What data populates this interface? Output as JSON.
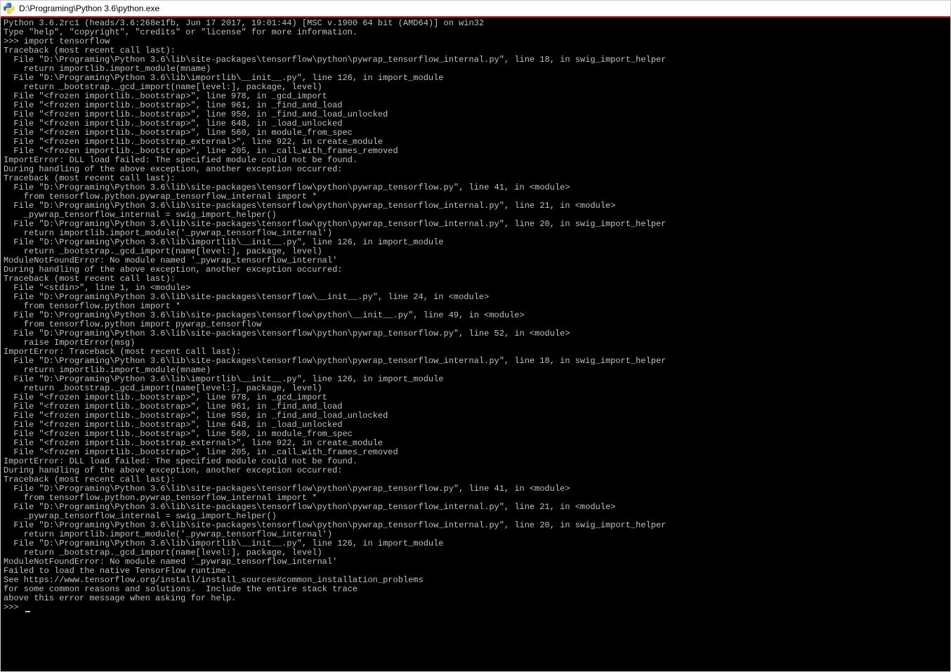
{
  "titlebar": {
    "title": "D:\\Programing\\Python 3.6\\python.exe"
  },
  "console": {
    "lines": [
      "Python 3.6.2rc1 (heads/3.6:268e1fb, Jun 17 2017, 19:01:44) [MSC v.1900 64 bit (AMD64)] on win32",
      "Type \"help\", \"copyright\", \"credits\" or \"license\" for more information.",
      ">>> import tensorflow",
      "Traceback (most recent call last):",
      "  File \"D:\\Programing\\Python 3.6\\lib\\site-packages\\tensorflow\\python\\pywrap_tensorflow_internal.py\", line 18, in swig_import_helper",
      "    return importlib.import_module(mname)",
      "  File \"D:\\Programing\\Python 3.6\\lib\\importlib\\__init__.py\", line 126, in import_module",
      "    return _bootstrap._gcd_import(name[level:], package, level)",
      "  File \"<frozen importlib._bootstrap>\", line 978, in _gcd_import",
      "  File \"<frozen importlib._bootstrap>\", line 961, in _find_and_load",
      "  File \"<frozen importlib._bootstrap>\", line 950, in _find_and_load_unlocked",
      "  File \"<frozen importlib._bootstrap>\", line 648, in _load_unlocked",
      "  File \"<frozen importlib._bootstrap>\", line 560, in module_from_spec",
      "  File \"<frozen importlib._bootstrap_external>\", line 922, in create_module",
      "  File \"<frozen importlib._bootstrap>\", line 205, in _call_with_frames_removed",
      "ImportError: DLL load failed: The specified module could not be found.",
      "",
      "During handling of the above exception, another exception occurred:",
      "",
      "Traceback (most recent call last):",
      "  File \"D:\\Programing\\Python 3.6\\lib\\site-packages\\tensorflow\\python\\pywrap_tensorflow.py\", line 41, in <module>",
      "    from tensorflow.python.pywrap_tensorflow_internal import *",
      "  File \"D:\\Programing\\Python 3.6\\lib\\site-packages\\tensorflow\\python\\pywrap_tensorflow_internal.py\", line 21, in <module>",
      "    _pywrap_tensorflow_internal = swig_import_helper()",
      "  File \"D:\\Programing\\Python 3.6\\lib\\site-packages\\tensorflow\\python\\pywrap_tensorflow_internal.py\", line 20, in swig_import_helper",
      "    return importlib.import_module('_pywrap_tensorflow_internal')",
      "  File \"D:\\Programing\\Python 3.6\\lib\\importlib\\__init__.py\", line 126, in import_module",
      "    return _bootstrap._gcd_import(name[level:], package, level)",
      "ModuleNotFoundError: No module named '_pywrap_tensorflow_internal'",
      "",
      "During handling of the above exception, another exception occurred:",
      "",
      "Traceback (most recent call last):",
      "  File \"<stdin>\", line 1, in <module>",
      "  File \"D:\\Programing\\Python 3.6\\lib\\site-packages\\tensorflow\\__init__.py\", line 24, in <module>",
      "    from tensorflow.python import *",
      "  File \"D:\\Programing\\Python 3.6\\lib\\site-packages\\tensorflow\\python\\__init__.py\", line 49, in <module>",
      "    from tensorflow.python import pywrap_tensorflow",
      "  File \"D:\\Programing\\Python 3.6\\lib\\site-packages\\tensorflow\\python\\pywrap_tensorflow.py\", line 52, in <module>",
      "    raise ImportError(msg)",
      "ImportError: Traceback (most recent call last):",
      "  File \"D:\\Programing\\Python 3.6\\lib\\site-packages\\tensorflow\\python\\pywrap_tensorflow_internal.py\", line 18, in swig_import_helper",
      "    return importlib.import_module(mname)",
      "  File \"D:\\Programing\\Python 3.6\\lib\\importlib\\__init__.py\", line 126, in import_module",
      "    return _bootstrap._gcd_import(name[level:], package, level)",
      "  File \"<frozen importlib._bootstrap>\", line 978, in _gcd_import",
      "  File \"<frozen importlib._bootstrap>\", line 961, in _find_and_load",
      "  File \"<frozen importlib._bootstrap>\", line 950, in _find_and_load_unlocked",
      "  File \"<frozen importlib._bootstrap>\", line 648, in _load_unlocked",
      "  File \"<frozen importlib._bootstrap>\", line 560, in module_from_spec",
      "  File \"<frozen importlib._bootstrap_external>\", line 922, in create_module",
      "  File \"<frozen importlib._bootstrap>\", line 205, in _call_with_frames_removed",
      "ImportError: DLL load failed: The specified module could not be found.",
      "",
      "During handling of the above exception, another exception occurred:",
      "",
      "Traceback (most recent call last):",
      "  File \"D:\\Programing\\Python 3.6\\lib\\site-packages\\tensorflow\\python\\pywrap_tensorflow.py\", line 41, in <module>",
      "    from tensorflow.python.pywrap_tensorflow_internal import *",
      "  File \"D:\\Programing\\Python 3.6\\lib\\site-packages\\tensorflow\\python\\pywrap_tensorflow_internal.py\", line 21, in <module>",
      "    _pywrap_tensorflow_internal = swig_import_helper()",
      "  File \"D:\\Programing\\Python 3.6\\lib\\site-packages\\tensorflow\\python\\pywrap_tensorflow_internal.py\", line 20, in swig_import_helper",
      "    return importlib.import_module('_pywrap_tensorflow_internal')",
      "  File \"D:\\Programing\\Python 3.6\\lib\\importlib\\__init__.py\", line 126, in import_module",
      "    return _bootstrap._gcd_import(name[level:], package, level)",
      "ModuleNotFoundError: No module named '_pywrap_tensorflow_internal'",
      "",
      "",
      "Failed to load the native TensorFlow runtime.",
      "",
      "See https://www.tensorflow.org/install/install_sources#common_installation_problems",
      "",
      "for some common reasons and solutions.  Include the entire stack trace",
      "above this error message when asking for help.",
      ">>> "
    ]
  }
}
